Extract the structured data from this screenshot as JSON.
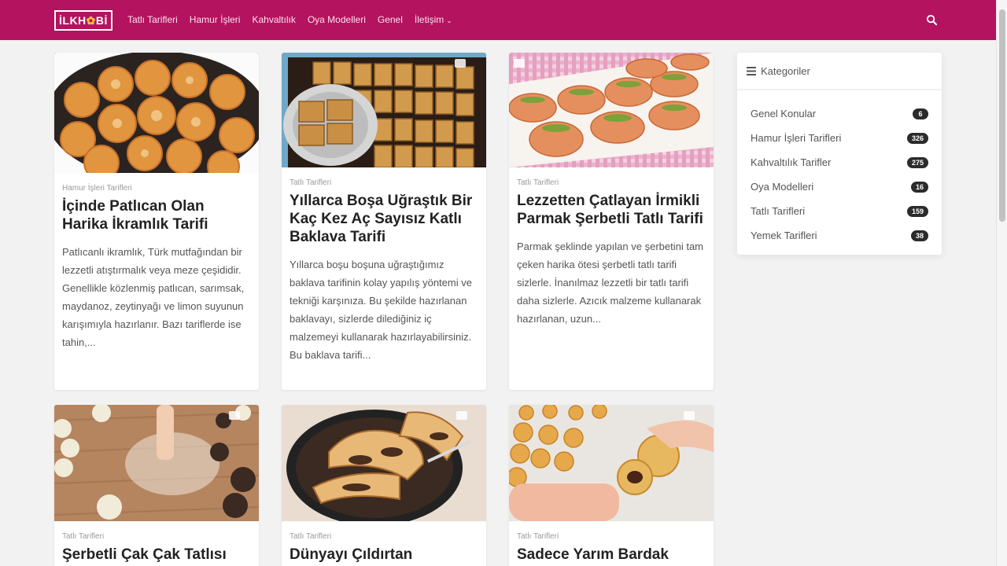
{
  "site": {
    "logo_left": "İLKH",
    "logo_star": "✿",
    "logo_right": "Bİ"
  },
  "nav": {
    "items": [
      "Tatlı Tarifleri",
      "Hamur İşleri",
      "Kahvaltılık",
      "Oya Modelleri",
      "Genel",
      "İletişim"
    ],
    "dropdown_caret": "⌄"
  },
  "posts": [
    {
      "category": "Hamur İşleri Tarifleri",
      "title": "İçinde Patlıcan Olan Harika İkramlık Tarifi",
      "excerpt": "Patlıcanlı ikramlık, Türk mutfağından bir lezzetli atıştırmalık veya meze çeşididir. Genellikle közlenmiş patlıcan, sarımsak, maydanoz, zeytinyağı ve limon suyunun karışımıyla hazırlanır. Bazı tariflerde ise tahin,..."
    },
    {
      "category": "Tatlı Tarifleri",
      "title": "Yıllarca Boşa Uğraştık Bir Kaç Kez Aç Sayısız Katlı Baklava Tarifi",
      "excerpt": "Yıllarca boşu boşuna uğraştığımız baklava tarifinin kolay yapılış yöntemi ve tekniği karşınıza. Bu şekilde hazırlanan baklavayı, sizlerde dilediğiniz iç malzemeyi kullanarak hazırlayabilirsiniz. Bu baklava tarifi..."
    },
    {
      "category": "Tatlı Tarifleri",
      "title": "Lezzetten Çatlayan İrmikli Parmak Şerbetli Tatlı Tarifi",
      "excerpt": "Parmak şeklinde yapılan ve şerbetini tam çeken harika ötesi şerbetli tatlı tarifi sizlerle. İnanılmaz lezzetli bir tatlı tarifi daha sizlerle. Azıcık malzeme kullanarak hazırlanan, uzun..."
    },
    {
      "category": "Tatlı Tarifleri",
      "title": "Şerbetli Çak Çak Tatlısı",
      "excerpt": ""
    },
    {
      "category": "Tatlı Tarifleri",
      "title": "Dünyayı Çıldırtan",
      "excerpt": ""
    },
    {
      "category": "Tatlı Tarifleri",
      "title": "Sadece Yarım Bardak",
      "excerpt": ""
    }
  ],
  "sidebar": {
    "title": "Kategoriler",
    "items": [
      {
        "label": "Genel Konular",
        "count": "6"
      },
      {
        "label": "Hamur İşleri Tarifleri",
        "count": "326"
      },
      {
        "label": "Kahvaltılık Tarifler",
        "count": "275"
      },
      {
        "label": "Oya Modelleri",
        "count": "16"
      },
      {
        "label": "Tatlı Tarifleri",
        "count": "159"
      },
      {
        "label": "Yemek Tarifleri",
        "count": "38"
      }
    ]
  },
  "colors": {
    "brand": "#b3135f",
    "badge": "#2b2b2b",
    "logo_accent": "#f7c53b"
  }
}
